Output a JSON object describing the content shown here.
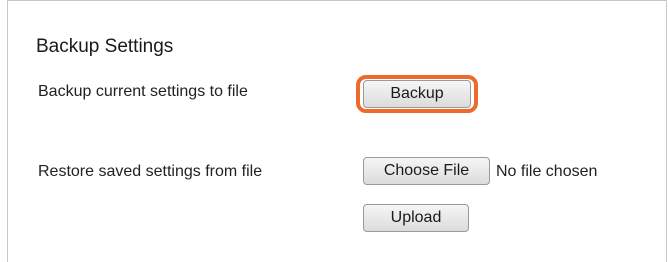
{
  "section": {
    "title": "Backup Settings"
  },
  "backup": {
    "label": "Backup current settings to file",
    "button_label": "Backup",
    "highlight_color": "#ec6a2a"
  },
  "restore": {
    "label": "Restore saved settings from file",
    "choose_file_label": "Choose File",
    "file_status": "No file chosen",
    "upload_label": "Upload"
  }
}
